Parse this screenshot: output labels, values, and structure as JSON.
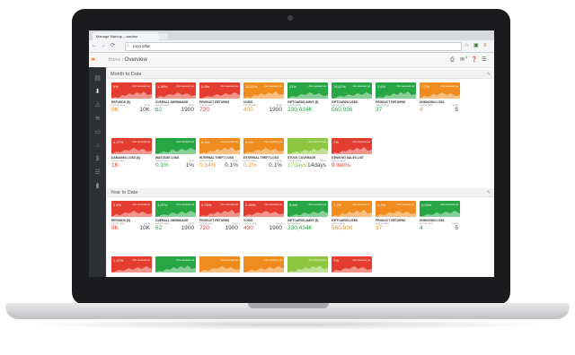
{
  "browser": {
    "tab_title": "Manage Markup – wadmn",
    "url": "rocd x/ba",
    "back_icon": "arrow-left-icon",
    "forward_icon": "arrow-right-icon",
    "reload_icon": "reload-icon"
  },
  "app": {
    "logo": "›››",
    "breadcrumb_root": "Home",
    "breadcrumb_separator": "›",
    "breadcrumb_current": "Overview",
    "header_badge": "2"
  },
  "sidebar": {
    "icons": [
      "docs-icon",
      "download-icon",
      "alert-icon",
      "wifi-icon",
      "monitor-icon",
      "tag-icon",
      "dollar-icon",
      "list-icon",
      "bookmark-icon"
    ],
    "active_index": 1
  },
  "colors": {
    "red": "#e43c2f",
    "green": "#27a744",
    "orange": "#f08c1d",
    "lightgreen": "#8dc63f"
  },
  "labels": {
    "current": "current value",
    "target": "target",
    "tag": "• Not received yet"
  },
  "sections": [
    {
      "title": "Month to Date",
      "rows": [
        [
          {
            "pct": "9%",
            "color": "red",
            "name": "REFUNDS ($)",
            "value": "9K",
            "target": "10K",
            "vcolor": "#f08c1d"
          },
          {
            "pct": "1.26%",
            "color": "red",
            "name": "OVERALL SHRINKAGE",
            "value": "62",
            "target": "1900",
            "vcolor": "#27a744"
          },
          {
            "pct": "5.6%",
            "color": "red",
            "name": "PRODUCT RETURNS",
            "value": "720",
            "target": "",
            "vcolor": "#e43c2f"
          },
          {
            "pct": "12.52%",
            "color": "orange",
            "name": "VOIDS",
            "value": "430",
            "target": "1900",
            "vcolor": "#f08c1d"
          },
          {
            "pct": "21%",
            "color": "green",
            "name": "GIFTCARDS AMNT ($)",
            "value": "230,434K",
            "target": "",
            "vcolor": "#27a744"
          },
          {
            "pct": "74.67%",
            "color": "green",
            "name": "GIFTCARDS USED",
            "value": "560,936",
            "target": "",
            "vcolor": "#27a744"
          },
          {
            "pct": "2.6%",
            "color": "green",
            "name": "PRODUCT RETURNS",
            "value": "37",
            "target": "",
            "vcolor": "#27a744"
          },
          {
            "pct": "7.7%",
            "color": "orange",
            "name": "UNKNOWN LOSS",
            "value": "4",
            "target": "5",
            "vcolor": "#f08c1d"
          }
        ],
        [
          {
            "pct": "1.27%",
            "color": "red",
            "name": "DAMAGED LOSS ($)",
            "value": "1K",
            "target": "",
            "vcolor": "#e43c2f"
          },
          {
            "pct": "",
            "color": "green",
            "name": "WASTAGE LOSS",
            "value": "0.1%",
            "target": "1%",
            "vcolor": "#27a744"
          },
          {
            "pct": "0.1%",
            "color": "orange",
            "name": "INTERNAL THEFT LOSS",
            "value": "0.14%",
            "target": "0.1%",
            "vcolor": "#f08c1d"
          },
          {
            "pct": "0.1%",
            "color": "orange",
            "name": "EXTERNAL THEFT LOSS",
            "value": "0.1%",
            "target": "0.1%",
            "vcolor": "#f08c1d"
          },
          {
            "pct": "",
            "color": "lightgreen",
            "name": "STOCK COVERAGE",
            "value": "17days",
            "target": "14days",
            "vcolor": "#8dc63f"
          },
          {
            "pct": "7%",
            "color": "red",
            "name": "ITEMS NO SALES LIST",
            "value": "9 items",
            "target": "",
            "vcolor": "#e43c2f"
          }
        ]
      ]
    },
    {
      "title": "Year to Date",
      "rows": [
        [
          {
            "pct": "0.4%",
            "color": "red",
            "name": "REFUNDS ($)",
            "value": "9K",
            "target": "10K",
            "vcolor": "#e43c2f"
          },
          {
            "pct": "1.27%",
            "color": "green",
            "name": "OVERALL SHRINKAGE",
            "value": "62",
            "target": "1900",
            "vcolor": "#27a744"
          },
          {
            "pct": "0.76%",
            "color": "red",
            "name": "PRODUCT RETURNS",
            "value": "720",
            "target": "1900",
            "vcolor": "#e43c2f"
          },
          {
            "pct": "2.26%",
            "color": "red",
            "name": "VOIDS",
            "value": "430",
            "target": "1900",
            "vcolor": "#e43c2f"
          },
          {
            "pct": "0.4%",
            "color": "green",
            "name": "GIFTCARDS AMNT ($)",
            "value": "230,434K",
            "target": "",
            "vcolor": "#27a744"
          },
          {
            "pct": "7.2%",
            "color": "orange",
            "name": "GIFTCARDS USED",
            "value": "560,936",
            "target": "",
            "vcolor": "#f08c1d"
          },
          {
            "pct": "0.2%",
            "color": "orange",
            "name": "PRODUCT RETURNS",
            "value": "37",
            "target": "",
            "vcolor": "#f08c1d"
          },
          {
            "pct": "0.03%",
            "color": "green",
            "name": "UNKNOWN LOSS",
            "value": "4",
            "target": "5",
            "vcolor": "#27a744"
          }
        ],
        [
          {
            "pct": "1.27%",
            "color": "red",
            "name": "",
            "value": "",
            "target": "",
            "vcolor": "#e43c2f"
          },
          {
            "pct": "",
            "color": "green",
            "name": "",
            "value": "",
            "target": "",
            "vcolor": "#27a744"
          },
          {
            "pct": "",
            "color": "orange",
            "name": "",
            "value": "",
            "target": "",
            "vcolor": "#f08c1d"
          },
          {
            "pct": "",
            "color": "orange",
            "name": "",
            "value": "",
            "target": "",
            "vcolor": "#f08c1d"
          },
          {
            "pct": "",
            "color": "lightgreen",
            "name": "",
            "value": "",
            "target": "",
            "vcolor": "#8dc63f"
          },
          {
            "pct": "7%",
            "color": "red",
            "name": "",
            "value": "",
            "target": "",
            "vcolor": "#e43c2f"
          }
        ]
      ]
    }
  ]
}
